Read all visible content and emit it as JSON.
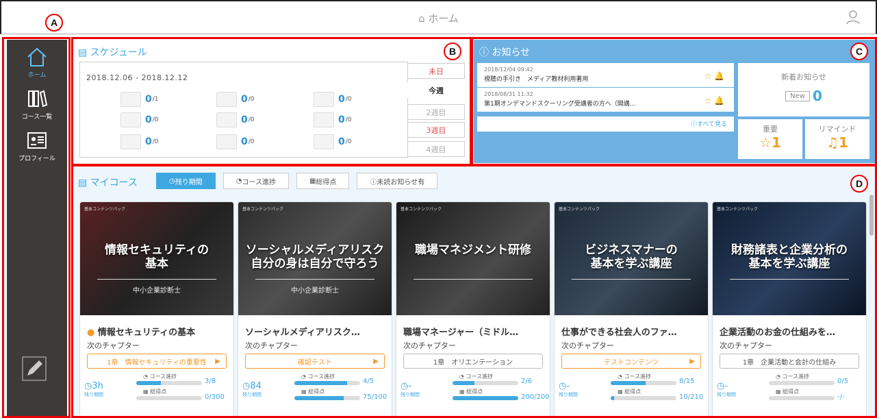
{
  "header": {
    "title": "ホーム"
  },
  "markers": {
    "a": "A",
    "b": "B",
    "c": "C",
    "d": "D"
  },
  "sidebar": {
    "items": [
      {
        "label": "ホーム",
        "icon": "home-icon"
      },
      {
        "label": "コース一覧",
        "icon": "books-icon"
      },
      {
        "label": "プロフィール",
        "icon": "profile-icon"
      }
    ]
  },
  "schedule": {
    "title": "スケジュール",
    "range": "2018.12.06 - 2018.12.12",
    "stats": [
      {
        "value": "0",
        "total": "/1"
      },
      {
        "value": "0",
        "total": "/0"
      },
      {
        "value": "0",
        "total": "/0"
      },
      {
        "value": "0",
        "total": "/0"
      },
      {
        "value": "0",
        "total": "/0"
      },
      {
        "value": "0",
        "total": "/0"
      },
      {
        "value": "0",
        "total": "/0"
      },
      {
        "value": "0",
        "total": "/0"
      },
      {
        "value": "0",
        "total": "/0"
      }
    ],
    "weeks": [
      "未日",
      "今週",
      "2週目",
      "3週目",
      "4週目"
    ]
  },
  "notices": {
    "title": "お知らせ",
    "items": [
      {
        "date": "2018/12/04 09:42",
        "text": "視聴の手引き　メディア教材利用著用"
      },
      {
        "date": "2018/08/31 11:32",
        "text": "第1期オンデマンドスクーリング受講者の方へ（開講…"
      }
    ],
    "see_all": "すべて見る",
    "new_label": "新着お知らせ",
    "new_badge": "New",
    "new_count": "0",
    "important_label": "重要",
    "important_count": "1",
    "remind_label": "リマインド",
    "remind_count": "1"
  },
  "mycourse": {
    "title": "マイコース",
    "tabs": [
      "残り期間",
      "コース進捗",
      "総得点",
      "未読お知らせ有"
    ],
    "next_label": "次のチャプター",
    "progress_label": "コース進捗",
    "score_label": "総得点",
    "remain_label": "残り期間",
    "courses": [
      {
        "tag": "基本コンテンツパック",
        "thumb_title": "情報セキュリティの\n基本",
        "thumb_sub": "中小企業診断士",
        "title": "情報セキュリティの基本",
        "chapter": "1章　情報セキュリティの重要性",
        "remain": "3h",
        "progress": "3/8",
        "score": "0/300",
        "progress_frac": 0.375,
        "score_frac": 0
      },
      {
        "tag": "基本コンテンツパック",
        "thumb_title": "ソーシャルメディアリスク\n自分の身は自分で守ろう",
        "thumb_sub": "中小企業診断士",
        "title": "ソーシャルメディアリスク…",
        "chapter": "確認テスト",
        "remain": "84",
        "progress": "4/5",
        "score": "75/100",
        "progress_frac": 0.8,
        "score_frac": 0.75
      },
      {
        "tag": "基本コンテンツパック",
        "thumb_title": "職場マネジメント研修",
        "thumb_sub": "",
        "title": "職場マネージャー（ミドル…",
        "chapter": "1章　オリエンテーション",
        "remain": "-",
        "progress": "2/6",
        "score": "200/200",
        "progress_frac": 0.333,
        "score_frac": 1
      },
      {
        "tag": "基本コンテンツパック",
        "thumb_title": "ビジネスマナーの\n基本を学ぶ講座",
        "thumb_sub": "",
        "title": "仕事ができる社会人のファ…",
        "chapter": "テストコンテンツ",
        "remain": "-",
        "progress": "8/15",
        "score": "10/210",
        "progress_frac": 0.533,
        "score_frac": 0.048
      },
      {
        "tag": "基本コンテンツパック",
        "thumb_title": "財務諸表と企業分析の\n基本を学ぶ講座",
        "thumb_sub": "",
        "title": "企業活動のお金の仕組みを…",
        "chapter": "1章　企業活動と会計の仕組み",
        "remain": "-",
        "progress": "0/5",
        "score": "-/-",
        "progress_frac": 0,
        "score_frac": 0
      }
    ]
  }
}
